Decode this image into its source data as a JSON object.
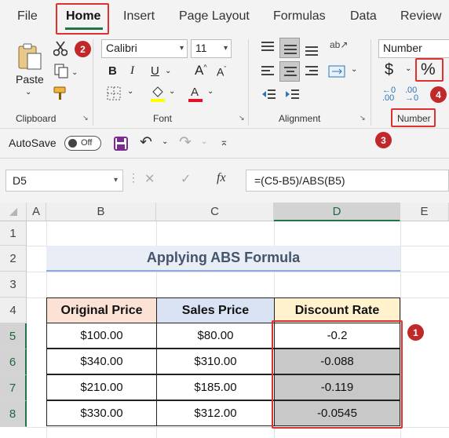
{
  "tabs": [
    "File",
    "Home",
    "Insert",
    "Page Layout",
    "Formulas",
    "Data",
    "Review"
  ],
  "ribbon": {
    "clipboard": {
      "paste_label": "Paste",
      "group_label": "Clipboard"
    },
    "font": {
      "name": "Calibri",
      "size": "11",
      "group_label": "Font"
    },
    "alignment": {
      "group_label": "Alignment"
    },
    "number": {
      "format": "Number",
      "group_label": "Number"
    }
  },
  "qat": {
    "autosave_label": "AutoSave",
    "toggle_label": "Off"
  },
  "formula_bar": {
    "name_box": "D5",
    "fx": "fx",
    "formula": "=(C5-B5)/ABS(B5)"
  },
  "columns": [
    "A",
    "B",
    "C",
    "D",
    "E"
  ],
  "rows": [
    "1",
    "2",
    "3",
    "4",
    "5",
    "6",
    "7",
    "8"
  ],
  "sheet": {
    "title": "Applying ABS Formula",
    "headers": [
      "Original Price",
      "Sales Price",
      "Discount Rate"
    ],
    "data": [
      [
        "$100.00",
        "$80.00",
        "-0.2"
      ],
      [
        "$340.00",
        "$310.00",
        "-0.088"
      ],
      [
        "$210.00",
        "$185.00",
        "-0.119"
      ],
      [
        "$330.00",
        "$312.00",
        "-0.0545"
      ]
    ]
  },
  "callouts": [
    "1",
    "2",
    "3",
    "4"
  ],
  "colors": {
    "excel_green": "#217346",
    "callout_red": "#c0282a",
    "header_orange": "#fbe2d5",
    "header_blue": "#dae3f3",
    "header_yellow": "#fff2cc",
    "selection_gray": "#c8c8c8"
  }
}
